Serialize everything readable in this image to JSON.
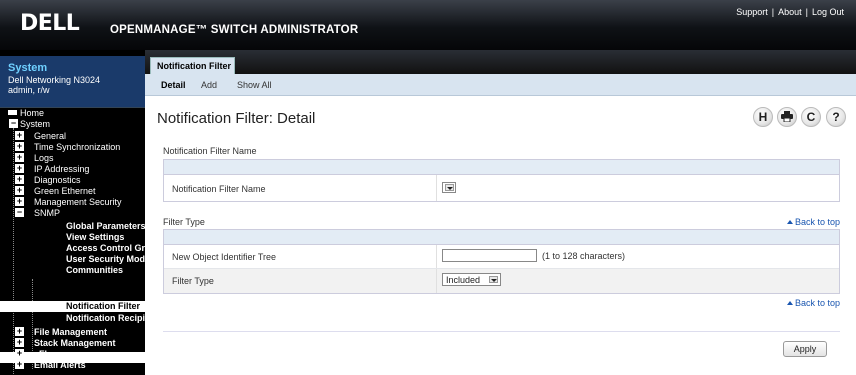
{
  "header": {
    "logo": "DELL",
    "app_title": "OPENMANAGE™ SWITCH ADMINISTRATOR",
    "links": [
      "Support",
      "About",
      "Log Out"
    ]
  },
  "sidebar": {
    "system_title": "System",
    "model": "Dell Networking N3024",
    "user": "admin, r/w",
    "tree": [
      {
        "label": "Home",
        "level": 0
      },
      {
        "label": "System",
        "level": 0
      },
      {
        "label": "General",
        "level": 1
      },
      {
        "label": "Time Synchronization",
        "level": 1
      },
      {
        "label": "Logs",
        "level": 1
      },
      {
        "label": "IP Addressing",
        "level": 1
      },
      {
        "label": "Diagnostics",
        "level": 1
      },
      {
        "label": "Green Ethernet",
        "level": 1
      },
      {
        "label": "Management Security",
        "level": 1
      },
      {
        "label": "SNMP",
        "level": 1
      },
      {
        "label": "Global Parameters",
        "level": 2
      },
      {
        "label": "View Settings",
        "level": 2
      },
      {
        "label": "Access Control Gro",
        "level": 2
      },
      {
        "label": "User Security Mode",
        "level": 2
      },
      {
        "label": "Communities",
        "level": 2
      },
      {
        "label": "Notification Filter",
        "level": 2,
        "selected": true
      },
      {
        "label": "Notification Recipie",
        "level": 2
      },
      {
        "label": "File Management",
        "level": 1
      },
      {
        "label": "Stack Management",
        "level": 1
      },
      {
        "label": "sFlow",
        "level": 1
      },
      {
        "label": "Email Alerts",
        "level": 1
      }
    ]
  },
  "tabs": {
    "main": "Notification Filter",
    "sub": [
      "Detail",
      "Add",
      "Show All"
    ]
  },
  "page": {
    "title": "Notification Filter: Detail",
    "icons": [
      "help-h-icon",
      "print-icon",
      "refresh-icon",
      "question-icon"
    ]
  },
  "sections": {
    "name_section": {
      "label": "Notification Filter Name",
      "row_label": "Notification Filter Name"
    },
    "filter_section": {
      "label": "Filter Type",
      "back_to_top": "Back to top",
      "oid_label": "New Object Identifier Tree",
      "oid_value": "",
      "oid_hint": "(1 to 128 characters)",
      "type_label": "Filter Type",
      "type_value": "Included"
    },
    "back_to_top_2": "Back to top"
  },
  "apply_label": "Apply"
}
